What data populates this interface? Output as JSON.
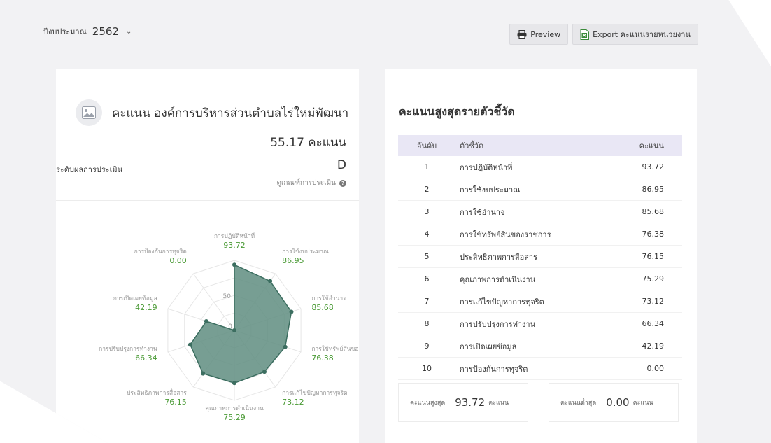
{
  "filter": {
    "label": "ปีงบประมาณ",
    "year": "2562"
  },
  "toolbar": {
    "preview_label": "Preview",
    "export_label": "Export คะแนนรายหน่วยงาน"
  },
  "org": {
    "title": "คะแนน องค์การบริหารส่วนตำบลไร่ใหม่พัฒนา",
    "score_text": "55.17 คะแนน",
    "grade_label": "ระดับผลการประเมิน",
    "grade": "D",
    "criteria_link": "ดูเกณฑ์การประเมิน"
  },
  "colors": {
    "accent_green": "#4a9a35",
    "radar_fill": "#5f8d80",
    "radar_stroke": "#3c6e60",
    "table_header_bg": "#e9e7f5"
  },
  "chart_data": {
    "type": "radar",
    "max": 100,
    "ring_labels": [
      "50",
      "0"
    ],
    "categories": [
      "การปฏิบัติหน้าที่",
      "การใช้งบประมาณ",
      "การใช้อำนาจ",
      "การใช้ทรัพย์สินของ",
      "การแก้ไขปัญหาการทุจริต",
      "คุณภาพการดำเนินงาน",
      "ประสิทธิภาพการสื่อสาร",
      "การปรับปรุงการทำงาน",
      "การเปิดเผยข้อมูล",
      "การป้องกันการทุจริต"
    ],
    "values": [
      93.72,
      86.95,
      85.68,
      76.38,
      73.12,
      75.29,
      76.15,
      66.34,
      42.19,
      0.0
    ],
    "value_labels": [
      "93.72",
      "86.95",
      "85.68",
      "76.38",
      "73.12",
      "75.29",
      "76.15",
      "66.34",
      "42.19",
      "0.00"
    ]
  },
  "ranking": {
    "title": "คะแนนสูงสุดรายตัวชี้วัด",
    "headers": {
      "rank": "อันดับ",
      "indicator": "ตัวชี้วัด",
      "score": "คะแนน"
    },
    "rows": [
      {
        "rank": "1",
        "indicator": "การปฏิบัติหน้าที่",
        "score": "93.72"
      },
      {
        "rank": "2",
        "indicator": "การใช้งบประมาณ",
        "score": "86.95"
      },
      {
        "rank": "3",
        "indicator": "การใช้อำนาจ",
        "score": "85.68"
      },
      {
        "rank": "4",
        "indicator": "การใช้ทรัพย์สินของราชการ",
        "score": "76.38"
      },
      {
        "rank": "5",
        "indicator": "ประสิทธิภาพการสื่อสาร",
        "score": "76.15"
      },
      {
        "rank": "6",
        "indicator": "คุณภาพการดำเนินงาน",
        "score": "75.29"
      },
      {
        "rank": "7",
        "indicator": "การแก้ไขปัญหาการทุจริต",
        "score": "73.12"
      },
      {
        "rank": "8",
        "indicator": "การปรับปรุงการทำงาน",
        "score": "66.34"
      },
      {
        "rank": "9",
        "indicator": "การเปิดเผยข้อมูล",
        "score": "42.19"
      },
      {
        "rank": "10",
        "indicator": "การป้องกันการทุจริต",
        "score": "0.00"
      }
    ]
  },
  "stats": {
    "max_label": "คะแนนสูงสุด",
    "max_value": "93.72",
    "max_unit": "คะแนน",
    "min_label": "คะแนนต่ำสุด",
    "min_value": "0.00",
    "min_unit": "คะแนน"
  }
}
